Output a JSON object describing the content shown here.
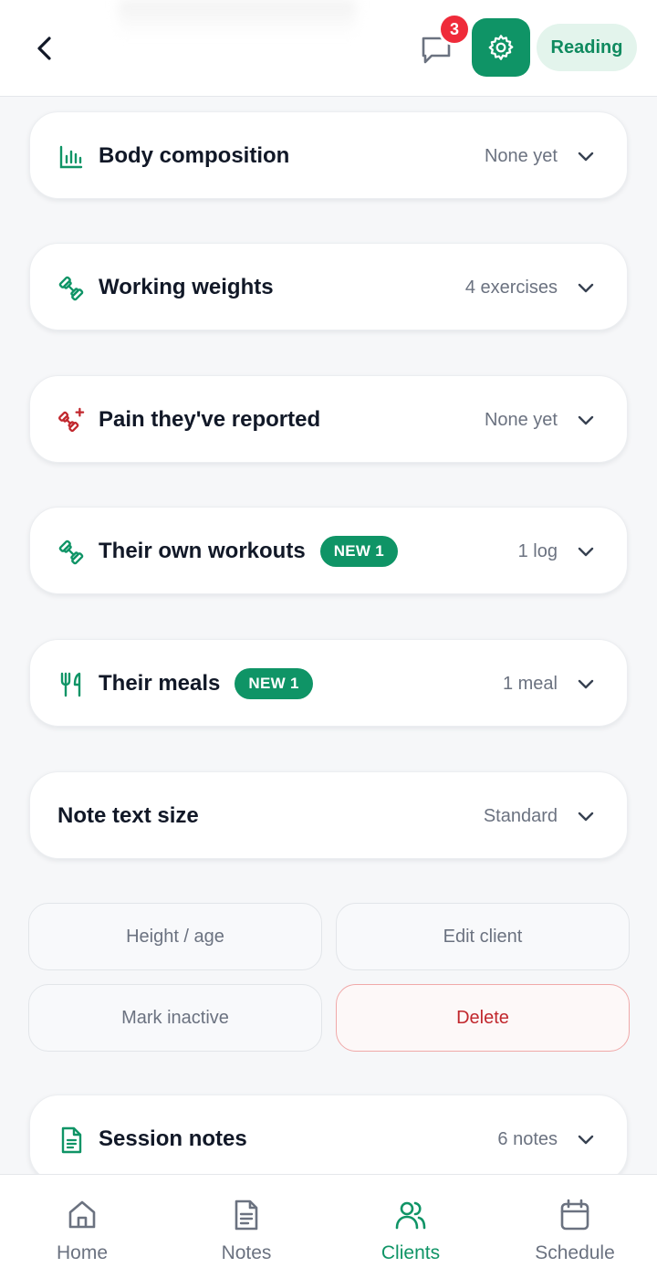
{
  "header": {
    "message_badge_count": "3",
    "reading_label": "Reading"
  },
  "sections": [
    {
      "title": "Body composition",
      "summary": "None yet",
      "icon": "bar-chart-icon",
      "icon_color": "#0f9466"
    },
    {
      "title": "Working weights",
      "summary": "4 exercises",
      "icon": "dumbbell-icon",
      "icon_color": "#0f9466"
    },
    {
      "title": "Pain they've reported",
      "summary": "None yet",
      "icon": "dumbbell-pain-icon",
      "icon_color": "#c1272d"
    },
    {
      "title": "Their own workouts",
      "badge": "NEW 1",
      "summary": "1 log",
      "icon": "dumbbell-icon",
      "icon_color": "#0f9466"
    },
    {
      "title": "Their meals",
      "badge": "NEW 1",
      "summary": "1 meal",
      "icon": "fork-knife-icon",
      "icon_color": "#0f9466"
    },
    {
      "title": "Note text size",
      "summary": "Standard"
    },
    {
      "title": "Session notes",
      "summary": "6 notes",
      "icon": "document-icon",
      "icon_color": "#0f9466"
    }
  ],
  "actions": {
    "height_age": "Height / age",
    "edit_client": "Edit client",
    "mark_inactive": "Mark inactive",
    "delete": "Delete"
  },
  "bottom_nav": [
    {
      "label": "Home",
      "icon": "home-icon"
    },
    {
      "label": "Notes",
      "icon": "notes-icon"
    },
    {
      "label": "Clients",
      "icon": "users-icon",
      "active": true
    },
    {
      "label": "Schedule",
      "icon": "calendar-icon"
    }
  ],
  "colors": {
    "accent": "#0f9466",
    "danger": "#c1272d",
    "badge_red": "#ef2b3a"
  }
}
